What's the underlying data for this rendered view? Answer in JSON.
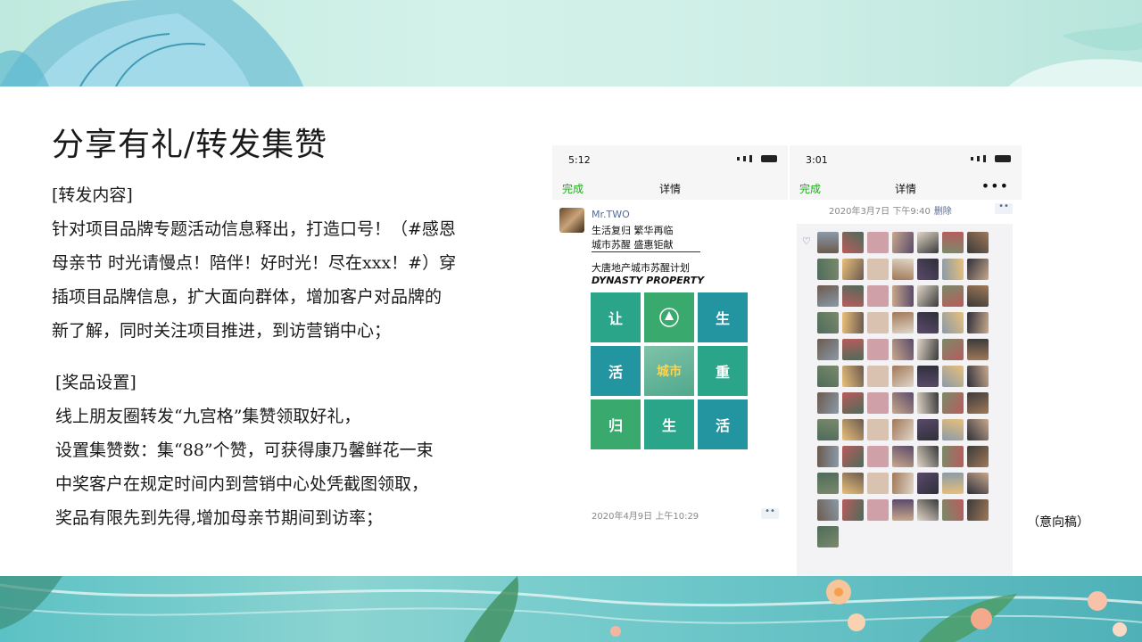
{
  "title": "分享有礼/转发集赞",
  "forward": {
    "lines": [
      "[转发内容]",
      "针对项目品牌专题活动信息释出，打造口号！（#感恩",
      "母亲节 时光请慢点！陪伴！好时光！尽在xxx！#）穿",
      "插项目品牌信息，扩大面向群体，增加客户对品牌的",
      "新了解，同时关注项目推进，到访营销中心；"
    ]
  },
  "prize": {
    "lines": [
      "[奖品设置]",
      "线上朋友圈转发“九宫格”集赞领取好礼，",
      "设置集赞数：集“88”个赞，可获得康乃馨鲜花一束",
      "中奖客户在规定时间内到营销中心处凭截图领取，",
      "奖品有限先到先得,增加母亲节期间到访率；"
    ]
  },
  "left_phone": {
    "time": "5:12",
    "done": "完成",
    "nav_title": "详情",
    "author": "Mr.TWO",
    "post_lines": [
      "生活复归  繁华再临",
      "城市苏醒  盛惠钜献"
    ],
    "brand_cn": "大唐地产城市苏醒计划",
    "brand_en": "DYNASTY PROPERTY",
    "grid": [
      "让",
      "",
      "生",
      "活",
      "城市",
      "重",
      "归",
      "生",
      "活"
    ],
    "date": "2020年4月9日 上午10:29"
  },
  "right_phone": {
    "time": "3:01",
    "done": "完成",
    "nav_title": "详情",
    "more": "•••",
    "date": "2020年3月7日 下午9:40",
    "delete": "删除",
    "heart": "♡"
  },
  "note": "（意向稿）",
  "colors": {
    "accent_green": "#1aad19",
    "link_blue": "#576b95",
    "tile_teal": "#2ba58a"
  }
}
